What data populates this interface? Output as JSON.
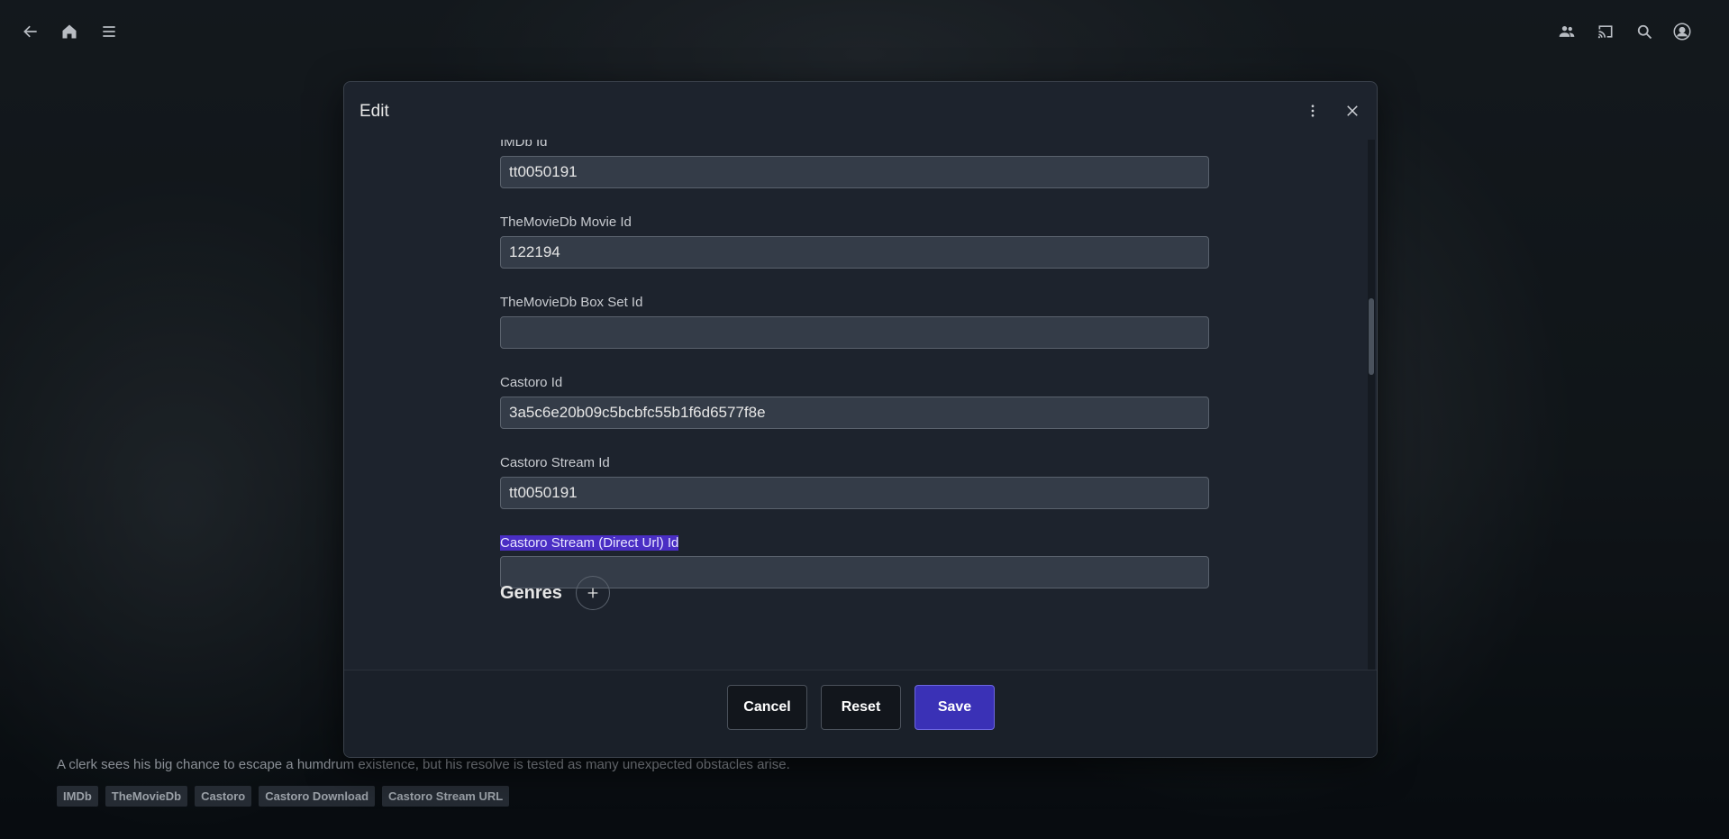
{
  "topbar": {
    "icons": [
      "back-arrow-icon",
      "home-icon",
      "menu-icon",
      "users-icon",
      "cast-icon",
      "search-icon",
      "user-avatar-icon"
    ]
  },
  "overview": {
    "text": "A clerk sees his big chance to escape a humdrum existence, but his resolve is tested as many unexpected obstacles arise."
  },
  "external_links": [
    "IMDb",
    "TheMovieDb",
    "Castoro",
    "Castoro Download",
    "Castoro Stream URL"
  ],
  "dialog": {
    "title": "Edit",
    "fields": [
      {
        "label": "IMDb Id",
        "value": "tt0050191"
      },
      {
        "label": "TheMovieDb Movie Id",
        "value": "122194"
      },
      {
        "label": "TheMovieDb Box Set Id",
        "value": ""
      },
      {
        "label": "Castoro Id",
        "value": "3a5c6e20b09c5bcbfc55b1f6d6577f8e"
      },
      {
        "label": "Castoro Stream Id",
        "value": "tt0050191"
      },
      {
        "label": "Castoro Stream (Direct Url) Id",
        "value": "",
        "label_selected": true
      }
    ],
    "genres_title": "Genres",
    "buttons": {
      "cancel": "Cancel",
      "reset": "Reset",
      "save": "Save"
    }
  },
  "colors": {
    "save_accent": "#3a31b6",
    "selection": "#4a2ec4",
    "dialog_bg": "#1d232d"
  }
}
